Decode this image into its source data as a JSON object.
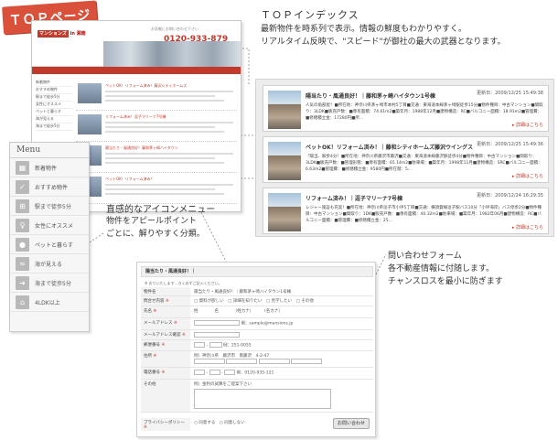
{
  "badge": {
    "label": "ＴＯＰページ"
  },
  "site": {
    "logo_text": "マンションズ",
    "logo_suffix": "in 湘南",
    "phone_label": "お気軽にお問い合わせ下さい",
    "phone": "0120-933-879",
    "sidebar": [
      "新着物件",
      "おすすめ物件",
      "駅まで徒歩5分",
      "女性にオススメ",
      "ペットと暮らす",
      "海が見える",
      "海まで徒歩5分"
    ],
    "rows": [
      "ペットOK！リフォーム済み！藤沢シティホームズ",
      "リフォーム済み！逗子マリーナ7号棟",
      "陽当たり・風通良好！藤和茅ヶ崎ハイタウン",
      "ペットOK！リフォーム済み！"
    ]
  },
  "top_index": {
    "title": "ＴＯＰインデックス",
    "lines": [
      "最新物件を時系列で表示。情報の鮮度もわかりやすく。",
      "リアルタイム反映で、\"スピード\"が御社の最大の武器となります。"
    ]
  },
  "cards": [
    {
      "title": "陽当たり・風通良好！｜藤和茅ヶ崎ハイタウン1号棟",
      "date": "更新日：2009/12/25 15:49:38",
      "desc": "人気の角部屋！■所在地：神奈川県茅ヶ崎市本村5丁目■交通：東海道本線茅ヶ崎駅徒歩15分■物件種目：中古マンション■間取り：3LDK■販売戸数：■専有面積：74.61m2■築年月：1988年12月■建物構造：RC■バルコニー面積：18.91m2■管理費：■修繕積立金：17280円■所...",
      "more": "詳細はこちら"
    },
    {
      "title": "ペットOK！リフォーム済み！｜藤和シティホームズ藤沢ウイングス",
      "date": "更新日：2009/12/25 15:49:36",
      "desc": "「陽当、駅歩4分！■所在地：神奈川県藤沢市藤沢■交通：東海道本線藤沢駅徒歩4分■物件種目：中古マンション■間取り：3LDK■販売戸数：■管理形態：■専有面積：65.14m2■駐車場：■築年月：1998年11月■建物構造：SRC■バルコニー面積：6.63m2■管理費：■修繕積立金：9580円■所在階：5...",
      "more": "詳細はこちら"
    },
    {
      "title": "リフォーム済み！｜逗子マリーナ7号棟",
      "date": "更新日：2009/12/24 16:29:35",
      "desc": "レジャー施設も充実！■所在地：神奈川県逗子市小坪5丁目■交通：横須賀線逗子駅バス10分「小坪海岸」バス停歩2分■物件種目：中古マンション■間取り：1DK■販売戸数：■専有面積：40.32m2■駐車場：■築年月：1982年06月■建物構造：RC■バルコニー面積：■管理費：■修繕積立金：25...",
      "more": "詳細はこちら"
    }
  ],
  "icon_menu": {
    "title": "直感的なアイコンメニュー",
    "lines": [
      "物件をアピールポイント",
      "ごとに、解りやすく分類。"
    ],
    "heading": "Menu",
    "items": [
      {
        "label": "新着物件",
        "icon": "building-icon"
      },
      {
        "label": "おすすめ物件",
        "icon": "thumbs-up-icon"
      },
      {
        "label": "駅まで徒歩5分",
        "icon": "train-icon"
      },
      {
        "label": "女性にオススメ",
        "icon": "woman-icon"
      },
      {
        "label": "ペットと暮らす",
        "icon": "paw-icon"
      },
      {
        "label": "海が見える",
        "icon": "sea-icon"
      },
      {
        "label": "海まで徒歩5分",
        "icon": "walk-icon"
      },
      {
        "label": "4LDK以上",
        "icon": "floorplan-icon"
      }
    ]
  },
  "contact": {
    "title": "問い合わせフォーム",
    "lines": [
      "各不動産情報に付随します。",
      "チャンスロスを最小に防ぎます"
    ]
  },
  "form": {
    "header": "陽当たり・風通良好！｜",
    "note": "※ おりいたします…きく必ずご記入ください。",
    "rows": [
      {
        "label": "物件名",
        "value": "陽当たり・風通良好！｜藤和茅ヶ崎ハイタウン1号棟",
        "req": ""
      },
      {
        "label": "問合せ内容",
        "value": "□ 資料が欲しい　□ 詳細を知りたい　□ 見学したい　□ その他",
        "req": "※"
      },
      {
        "label": "氏名",
        "value": "姓　　　　名　　　　（姓カナ）　　　（名カナ）",
        "req": "※"
      },
      {
        "label": "メールアドレス",
        "value": "例：sample@mansions.jp",
        "req": "※"
      },
      {
        "label": "メールアドレス確認",
        "value": "",
        "req": "※"
      },
      {
        "label": "郵便番号",
        "value": "例：251-0055",
        "req": "※"
      },
      {
        "label": "住所",
        "value": "例）神奈川県　藤沢市　南藤沢　4-2-47",
        "req": "※"
      },
      {
        "label": "電話番号",
        "value": "例：0120-935-121",
        "req": "※"
      },
      {
        "label": "その他",
        "value": "例）金利の試算をご提案下さい",
        "req": ""
      },
      {
        "label": "プライバシーポリシー",
        "value": "○ 同意する　○ 同意しない",
        "req": "※"
      }
    ],
    "submit": "お問い合わせ"
  }
}
